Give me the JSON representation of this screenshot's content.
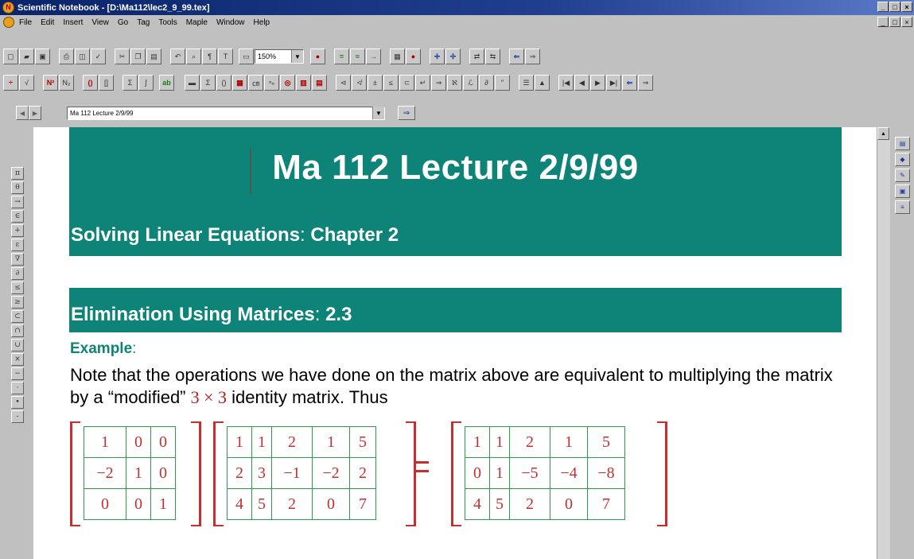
{
  "window": {
    "title": "Scientific Notebook - [D:\\Ma112\\lec2_9_99.tex]",
    "min": "_",
    "max": "□",
    "close": "×"
  },
  "menu": [
    "File",
    "Edit",
    "Insert",
    "View",
    "Go",
    "Tag",
    "Tools",
    "Maple",
    "Window",
    "Help"
  ],
  "toolbar": {
    "zoom": "150%"
  },
  "nav": {
    "tag_value": "Ma 112 Lecture 2/9/99"
  },
  "doc": {
    "title": "Ma 112 Lecture 2/9/99",
    "subtitle_main": "Solving Linear Equations",
    "subtitle_sep": ":",
    "subtitle_chapter": "Chapter 2",
    "section_main": "Elimination Using Matrices",
    "section_sep": ":",
    "section_num": "2.3",
    "example_label": "Example",
    "example_sep": ":",
    "body_1": "Note that the operations we have done on the matrix above are equivalent to multiplying the matrix by a “modified” ",
    "body_math": "3 × 3",
    "body_2": " identity matrix. Thus"
  },
  "matrices": {
    "a": [
      [
        "1",
        "0",
        "0"
      ],
      [
        "−2",
        "1",
        "0"
      ],
      [
        "0",
        "0",
        "1"
      ]
    ],
    "b": [
      [
        "1",
        "1",
        "2",
        "1",
        "5"
      ],
      [
        "2",
        "3",
        "−1",
        "−2",
        "2"
      ],
      [
        "4",
        "5",
        "2",
        "0",
        "7"
      ]
    ],
    "c": [
      [
        "1",
        "1",
        "2",
        "1",
        "5"
      ],
      [
        "0",
        "1",
        "−5",
        "−4",
        "−8"
      ],
      [
        "4",
        "5",
        "2",
        "0",
        "7"
      ]
    ]
  },
  "colors": {
    "teal": "#0e8478",
    "matrix_red": "#c23030",
    "grid_green": "#2e9a4a"
  }
}
